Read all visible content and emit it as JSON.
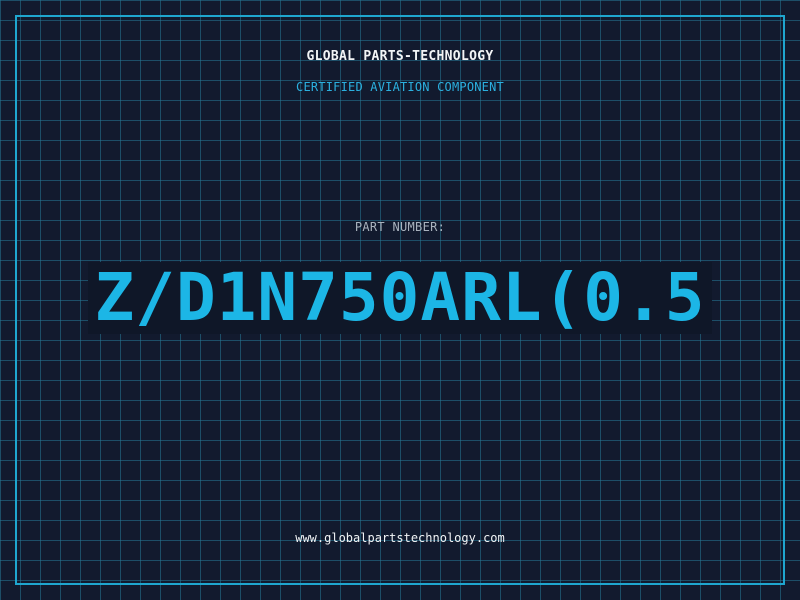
{
  "header": {
    "company": "GLOBAL PARTS-TECHNOLOGY",
    "subtitle": "CERTIFIED AVIATION COMPONENT"
  },
  "part": {
    "label": "PART NUMBER:",
    "number": "Z/D1N750ARL(0.5"
  },
  "footer": {
    "website": "www.globalpartstechnology.com"
  },
  "colors": {
    "background": "#121a2e",
    "grid": "#26788f",
    "border": "#1fa6cf",
    "accent": "#1cb6e6",
    "text": "#f2f4f6",
    "muted": "#a9b2bd"
  }
}
